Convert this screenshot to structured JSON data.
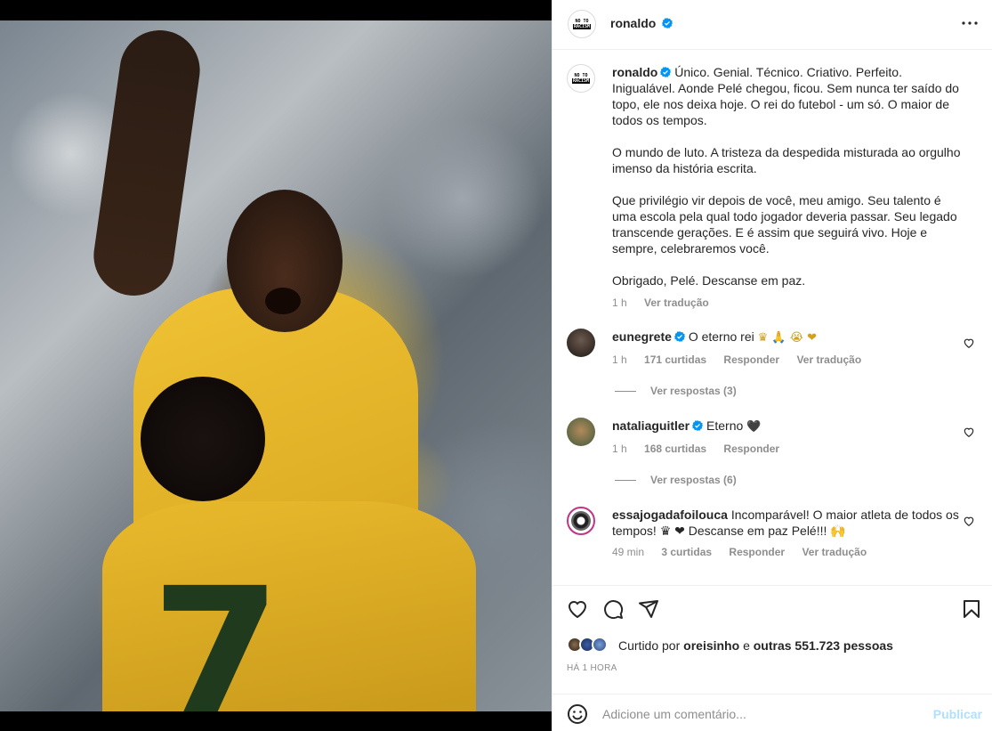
{
  "post": {
    "author": "ronaldo",
    "author_avatar_text": [
      "NO TO",
      "RACISM"
    ],
    "more_label": "More options"
  },
  "caption": {
    "username": "ronaldo",
    "text": "Único. Genial. Técnico. Criativo. Perfeito. Inigualável. Aonde Pelé chegou, ficou. Sem nunca ter saído do topo, ele nos deixa hoje. O rei do futebol - um só. O maior de todos os tempos.\n\nO mundo de luto. A tristeza da despedida misturada ao orgulho imenso da história escrita.\n\nQue privilégio vir depois de você, meu amigo. Seu talento é uma escola pela qual todo jogador deveria passar. Seu legado transcende gerações. E é assim que seguirá vivo. Hoje e sempre, celebraremos você.\n\nObrigado, Pelé. Descanse em paz.",
    "time": "1 h",
    "translate": "Ver tradução"
  },
  "comments": [
    {
      "username": "eunegrete",
      "text": "O eterno rei",
      "emojis": "♛ 🙏 😭 ❤",
      "time": "1 h",
      "likes": "171 curtidas",
      "reply": "Responder",
      "translate": "Ver tradução",
      "view_replies": "Ver respostas (3)"
    },
    {
      "username": "nataliaguitler",
      "text": "Eterno",
      "emojis": "🖤",
      "time": "1 h",
      "likes": "168 curtidas",
      "reply": "Responder",
      "view_replies": "Ver respostas (6)"
    },
    {
      "username": "essajogadafoilouca",
      "text": "Incomparável! O maior atleta de todos os tempos! ♛ ❤ Descanse em paz Pelé!!! 🙌",
      "time": "49 min",
      "likes": "3 curtidas",
      "reply": "Responder",
      "translate": "Ver tradução"
    }
  ],
  "likes": {
    "prefix": "Curtido por",
    "user": "oreisinho",
    "connector": "e",
    "others": "outras 551.723 pessoas"
  },
  "timestamp": "HÁ 1 HORA",
  "add_comment": {
    "placeholder": "Adicione um comentário...",
    "publish": "Publicar"
  },
  "colors": {
    "verified": "#0095f6",
    "muted": "#8e8e8e",
    "publish_disabled": "#b2dffc",
    "heart_red": "#ed4956"
  }
}
